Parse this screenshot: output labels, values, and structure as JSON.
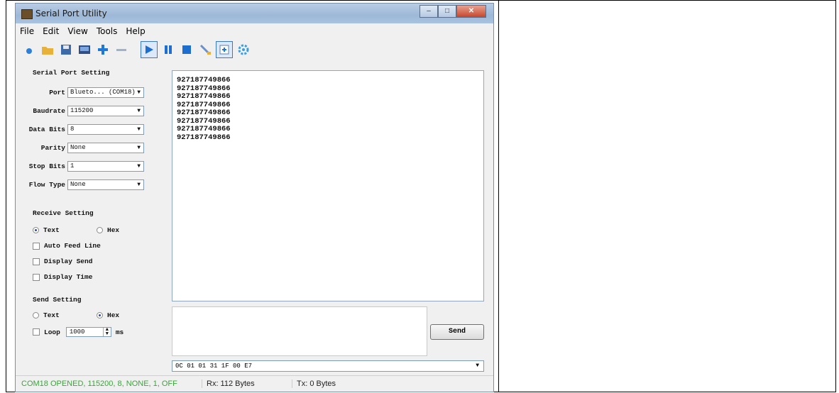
{
  "window": {
    "title": "Serial Port Utility"
  },
  "menu": {
    "file": "File",
    "edit": "Edit",
    "view": "View",
    "tools": "Tools",
    "help": "Help"
  },
  "serial_setting": {
    "heading": "Serial Port Setting",
    "port_label": "Port",
    "port_value": "Blueto... (COM18)",
    "baud_label": "Baudrate",
    "baud_value": "115200",
    "databits_label": "Data Bits",
    "databits_value": "8",
    "parity_label": "Parity",
    "parity_value": "None",
    "stopbits_label": "Stop Bits",
    "stopbits_value": "1",
    "flow_label": "Flow Type",
    "flow_value": "None"
  },
  "receive_setting": {
    "heading": "Receive Setting",
    "text_label": "Text",
    "hex_label": "Hex",
    "auto_feed": "Auto Feed Line",
    "display_send": "Display Send",
    "display_time": "Display Time"
  },
  "send_setting": {
    "heading": "Send Setting",
    "text_label": "Text",
    "hex_label": "Hex",
    "loop_label": "Loop",
    "loop_value": "1000",
    "loop_unit": "ms"
  },
  "receive_lines": [
    "927187749866",
    "927187749866",
    "927187749866",
    "927187749866",
    "927187749866",
    "927187749866",
    "927187749866",
    "927187749866"
  ],
  "send_button": "Send",
  "hex_input": "0C 01 01 31 1F 00 E7",
  "status": {
    "connection": "COM18 OPENED, 115200, 8, NONE, 1, OFF",
    "rx": "Rx: 112 Bytes",
    "tx": "Tx: 0 Bytes"
  },
  "colors": {
    "status_ok": "#3aa53a",
    "toolbar_blue": "#1e78d6"
  }
}
